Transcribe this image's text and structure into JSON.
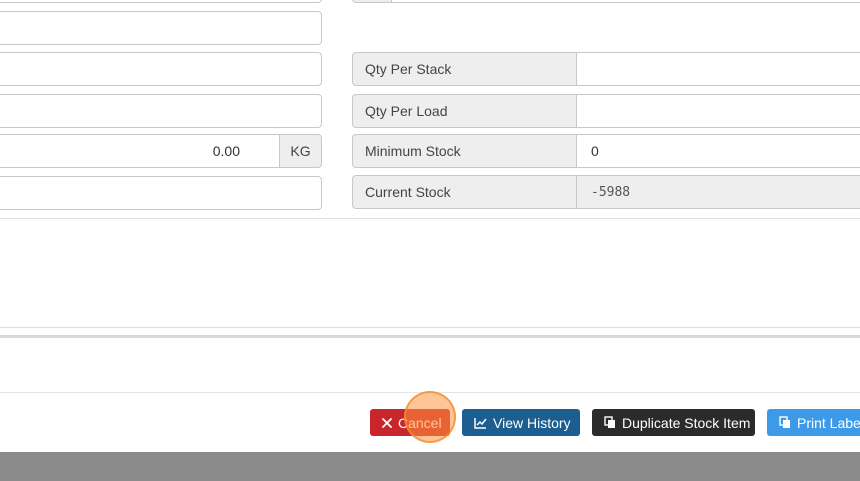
{
  "left_fields": {
    "weight_value": "0.00",
    "weight_unit": "KG"
  },
  "right_fields": [
    {
      "label": "Qty Per Stack",
      "value": ""
    },
    {
      "label": "Qty Per Load",
      "value": ""
    },
    {
      "label": "Minimum Stock",
      "value": "0"
    },
    {
      "label": "Current Stock",
      "value": "-5988"
    }
  ],
  "actions": {
    "cancel": {
      "label": "Cancel",
      "icon": "close-icon",
      "color": "#c9252d"
    },
    "view_history": {
      "label": "View History",
      "icon": "line-chart-icon",
      "color": "#1b5e8f"
    },
    "duplicate": {
      "label": "Duplicate Stock Item",
      "icon": "copy-icon",
      "color": "#2b2b2b"
    },
    "print_labels": {
      "label": "Print Labels",
      "icon": "copy-icon",
      "color": "#3d9ae8"
    }
  }
}
